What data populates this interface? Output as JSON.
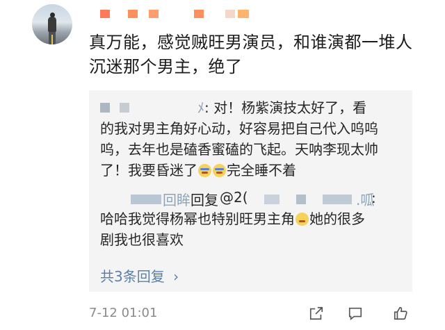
{
  "author": {
    "avatar": "avatar-photo-road",
    "name_mosaic_colors": [
      "#ff7a59",
      "#ff8f5c",
      "#ff9d6e",
      "#ff8f5c",
      "#ffb36b",
      "#f3d7c8"
    ]
  },
  "comment": {
    "text": "真万能，感觉贼旺男演员，和谁演都一堆人沉迷那个男主，绝了"
  },
  "replies": [
    {
      "author_suffix": "ﾒ",
      "text": ": 对！杨紫演技太好了，看的我对男主角好心动，好容易把自己代入呜呜呜，去年也是磕香蜜磕的飞起。天呐李现太帅了！我要昏迷了",
      "emoji1": "crying-emoji",
      "emoji2": "crying-emoji",
      "tail": "完全睡不着"
    },
    {
      "name_faded": "回眸",
      "action": "回复",
      "mention": "@2(",
      "target_faded": ".呱",
      "text": ":哈哈我觉得杨幂也特别旺男主角",
      "emoji": "laughing-emoji",
      "tail": "她的很多剧我也很喜欢"
    }
  ],
  "more_replies": "共3条回复",
  "more_replies_arrow": "›",
  "timestamp": "7-12 01:01",
  "actions": {
    "share_icon": "share-icon",
    "comment_icon": "comment-icon",
    "like_icon": "like-icon"
  }
}
